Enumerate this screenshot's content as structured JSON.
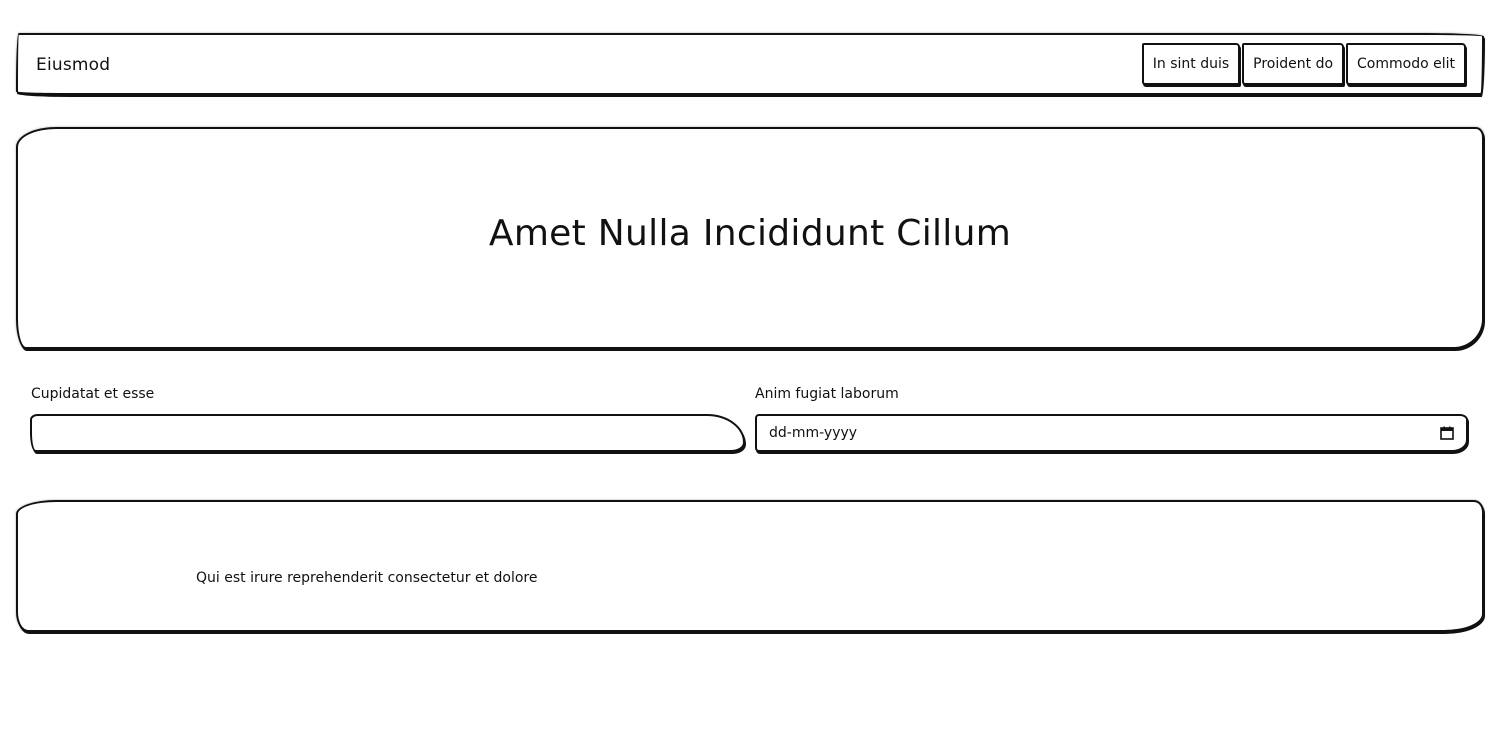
{
  "navbar": {
    "brand": "Eiusmod",
    "links": [
      {
        "label": "In sint duis"
      },
      {
        "label": "Proident do"
      },
      {
        "label": "Commodo elit"
      }
    ]
  },
  "hero": {
    "title": "Amet Nulla Incididunt Cillum"
  },
  "form": {
    "text_field": {
      "label": "Cupidatat et esse",
      "value": ""
    },
    "date_field": {
      "label": "Anim fugiat laborum",
      "placeholder": "dd-mm-yyyy",
      "icon": "calendar-icon"
    }
  },
  "content": {
    "text": "Qui est irure reprehenderit consectetur et dolore"
  }
}
